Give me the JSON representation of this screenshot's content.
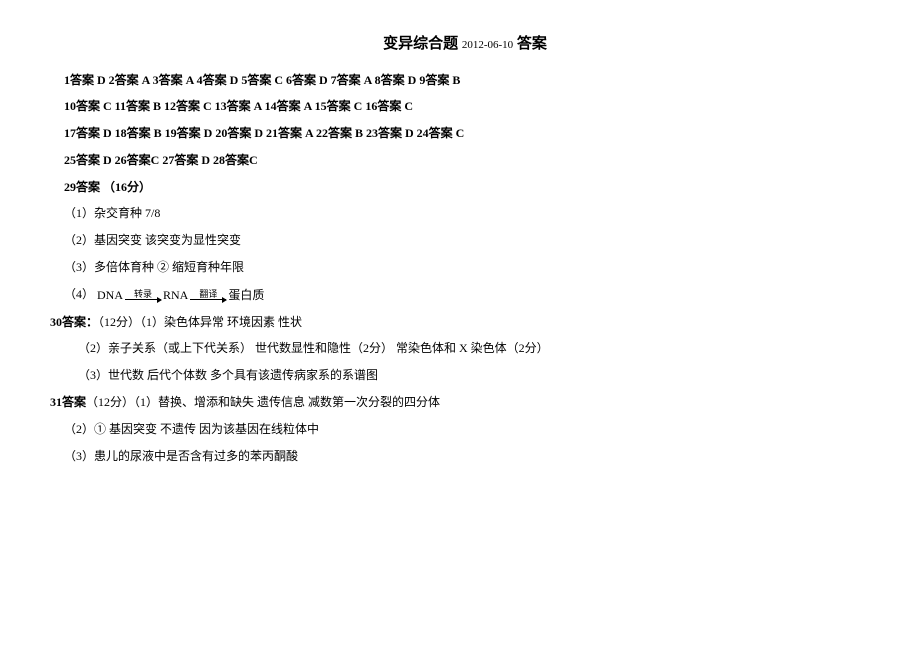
{
  "title": {
    "main": "变异综合题",
    "date": "2012-06-10",
    "suffix": "答案"
  },
  "answers_rows": [
    "1答案 D   2答案 A     3答案 A   4答案 D   5答案 C   6答案 D     7答案 A   8答案 D   9答案   B",
    "10答案   C   11答案   B   12答案   C   13答案   A   14答案    A    15答案 C    16答案 C",
    "17答案 D   18答案 B   19答案 D   20答案 D     21答案 A   22答案 B   23答案 D    24答案 C",
    "25答案  D     26答案C    27答案  D   28答案C"
  ],
  "q29": {
    "head": "29答案  （16分）",
    "p1": "（1）杂交育种        7/8",
    "p2": "（2）基因突变    该突变为显性突变",
    "p3": "（3）多倍体育种        ②           缩短育种年限",
    "p4_prefix": "（4）",
    "flow": {
      "a": "DNA",
      "l1": "转录",
      "b": "RNA",
      "l2": "翻译",
      "c": "蛋白质"
    }
  },
  "q30": {
    "head": "30答案：",
    "head_rest": "（12分）（1）染色体异常    环境因素    性状",
    "p2": "（2）亲子关系（或上下代关系）    世代数显性和隐性（2分）  常染色体和 X 染色体（2分）",
    "p3": "（3）世代数    后代个体数    多个具有该遗传病家系的系谱图"
  },
  "q31": {
    "head": "31答案",
    "head_rest": "（12分）（1）替换、增添和缺失     遗传信息         减数第一次分裂的四分体",
    "p2": "（2）①   基因突变   不遗传    因为该基因在线粒体中",
    "p3": "（3）患儿的尿液中是否含有过多的苯丙酮酸"
  }
}
